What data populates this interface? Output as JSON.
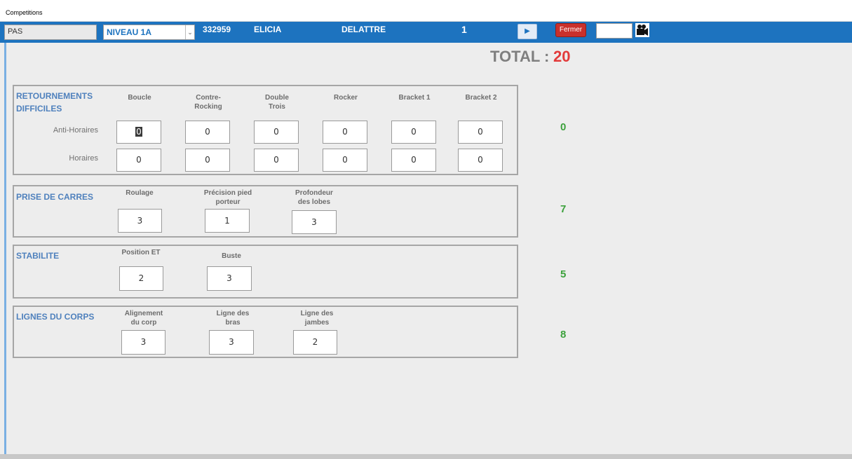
{
  "window": {
    "title": "Competitions"
  },
  "toolbar": {
    "field1": "PAS",
    "niveau": "NIVEAU 1A",
    "id": "332959",
    "first_name": "ELICIA",
    "last_name": "DELATTRE",
    "counter": "1",
    "fermer_label": "Fermer",
    "play_icon": "play-icon",
    "camera_icon": "video-camera-icon"
  },
  "total": {
    "label": "TOTAL :",
    "value": "20"
  },
  "sections": {
    "retournements": {
      "title_line1": "RETOURNEMENTS",
      "title_line2": "DIFFICILES",
      "columns": [
        "Boucle",
        "Contre-\nRocking",
        "Double\nTrois",
        "Rocker",
        "Bracket 1",
        "Bracket 2"
      ],
      "rows": [
        {
          "label": "Anti-Horaires",
          "values": [
            "0",
            "0",
            "0",
            "0",
            "0",
            "0"
          ]
        },
        {
          "label": "Horaires",
          "values": [
            "0",
            "0",
            "0",
            "0",
            "0",
            "0"
          ]
        }
      ],
      "score": "0"
    },
    "prise": {
      "title": "PRISE DE CARRES",
      "columns": [
        "Roulage",
        "Précision pied\nporteur",
        "Profondeur\ndes lobes"
      ],
      "values": [
        "3",
        "1",
        "3"
      ],
      "score": "7"
    },
    "stabilite": {
      "title": "STABILITE",
      "columns": [
        "Position ET",
        "Buste"
      ],
      "values": [
        "2",
        "3"
      ],
      "score": "5"
    },
    "lignes": {
      "title": "LIGNES DU CORPS",
      "columns": [
        "Alignement\ndu corp",
        "Ligne des\nbras",
        "Ligne des\njambes"
      ],
      "values": [
        "3",
        "3",
        "2"
      ],
      "score": "8"
    }
  },
  "colors": {
    "toolbar_bg": "#1d73bf",
    "section_title": "#4f81bd",
    "total_value": "#e23a3a",
    "score": "#3ca13c",
    "fermer_bg": "#c9302c"
  }
}
